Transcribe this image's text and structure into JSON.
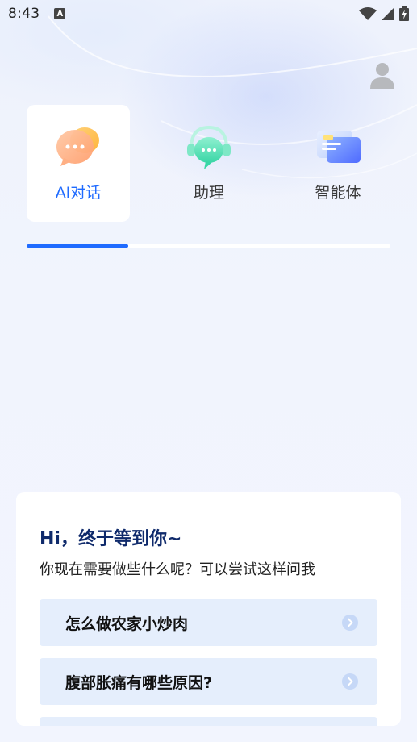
{
  "status_bar": {
    "time": "8:43",
    "notification_icon": "text-a-icon"
  },
  "header": {
    "profile_icon": "user-icon"
  },
  "tabs": [
    {
      "label": "AI对话",
      "icon": "chat-bubbles-icon",
      "active": true
    },
    {
      "label": "助理",
      "icon": "headset-assistant-icon",
      "active": false
    },
    {
      "label": "智能体",
      "icon": "cards-agent-icon",
      "active": false
    }
  ],
  "tab_progress": 0.28,
  "card": {
    "greeting": "Hi，终于等到你~",
    "subtitle": "你现在需要做些什么呢？可以尝试这样问我",
    "suggestions": [
      "怎么做农家小炒肉",
      "腹部胀痛有哪些原因?"
    ]
  },
  "colors": {
    "accent": "#1f6bff",
    "greeting": "#0f2a6b",
    "suggestion_bg": "#e5eefc",
    "page_bg": "#f0f4fd"
  }
}
